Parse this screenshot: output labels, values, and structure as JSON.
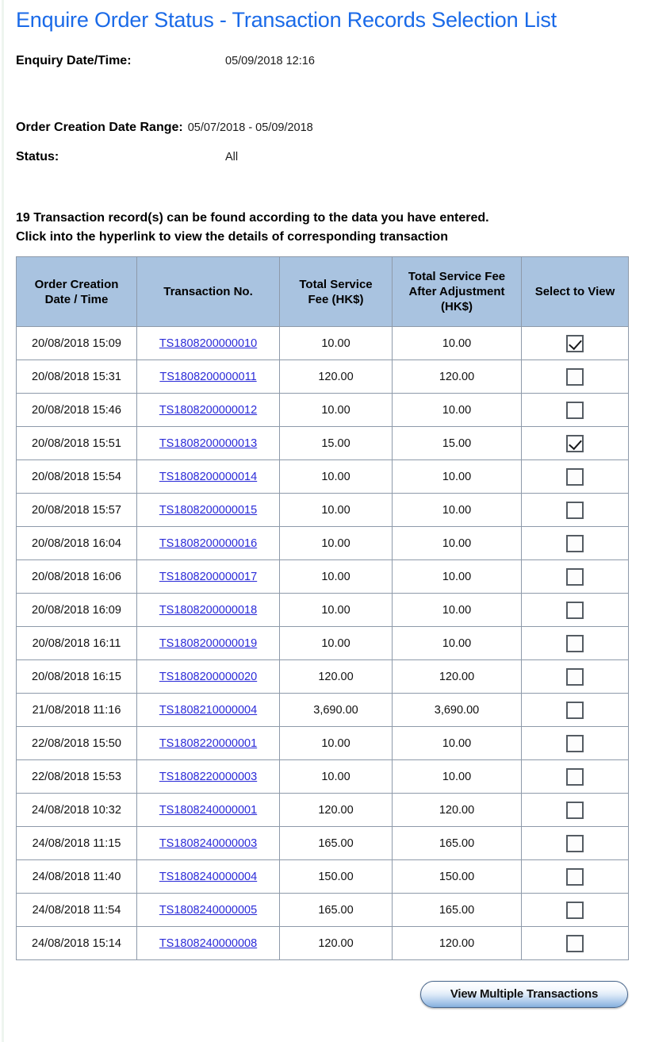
{
  "page": {
    "title": "Enquire Order Status - Transaction Records Selection List",
    "title_color": "#1a6ae8"
  },
  "meta": {
    "enquiry_label": "Enquiry Date/Time:",
    "enquiry_value": "05/09/2018 12:16",
    "date_range_label": "Order Creation Date Range:",
    "date_range_value": "05/07/2018 - 05/09/2018",
    "status_label": "Status:",
    "status_value": "All"
  },
  "result_note": {
    "line1": "19 Transaction record(s) can be found according to the data you have entered.",
    "line2": "Click into the hyperlink to view the details of corresponding transaction",
    "record_count": 19
  },
  "table": {
    "header_bg": "#a9c3e0",
    "columns": [
      "Order Creation Date / Time",
      "Transaction No.",
      "Total Service Fee (HK$)",
      "Total Service Fee After Adjustment (HK$)",
      "Select to View"
    ],
    "columns_lines": [
      [
        "Order Creation",
        "Date / Time"
      ],
      [
        "Transaction No."
      ],
      [
        "Total Service",
        "Fee (HK$)"
      ],
      [
        "Total Service Fee",
        "After Adjustment",
        "(HK$)"
      ],
      [
        "Select to View"
      ]
    ],
    "link_color": "#2b2bd8",
    "rows": [
      {
        "date": "20/08/2018 15:09",
        "txn": "TS1808200000010",
        "fee": "10.00",
        "fee_adj": "10.00",
        "selected": true
      },
      {
        "date": "20/08/2018 15:31",
        "txn": "TS1808200000011",
        "fee": "120.00",
        "fee_adj": "120.00",
        "selected": false
      },
      {
        "date": "20/08/2018 15:46",
        "txn": "TS1808200000012",
        "fee": "10.00",
        "fee_adj": "10.00",
        "selected": false
      },
      {
        "date": "20/08/2018 15:51",
        "txn": "TS1808200000013",
        "fee": "15.00",
        "fee_adj": "15.00",
        "selected": true
      },
      {
        "date": "20/08/2018 15:54",
        "txn": "TS1808200000014",
        "fee": "10.00",
        "fee_adj": "10.00",
        "selected": false
      },
      {
        "date": "20/08/2018 15:57",
        "txn": "TS1808200000015",
        "fee": "10.00",
        "fee_adj": "10.00",
        "selected": false
      },
      {
        "date": "20/08/2018 16:04",
        "txn": "TS1808200000016",
        "fee": "10.00",
        "fee_adj": "10.00",
        "selected": false
      },
      {
        "date": "20/08/2018 16:06",
        "txn": "TS1808200000017",
        "fee": "10.00",
        "fee_adj": "10.00",
        "selected": false
      },
      {
        "date": "20/08/2018 16:09",
        "txn": "TS1808200000018",
        "fee": "10.00",
        "fee_adj": "10.00",
        "selected": false
      },
      {
        "date": "20/08/2018 16:11",
        "txn": "TS1808200000019",
        "fee": "10.00",
        "fee_adj": "10.00",
        "selected": false
      },
      {
        "date": "20/08/2018 16:15",
        "txn": "TS1808200000020",
        "fee": "120.00",
        "fee_adj": "120.00",
        "selected": false
      },
      {
        "date": "21/08/2018 11:16",
        "txn": "TS1808210000004",
        "fee": "3,690.00",
        "fee_adj": "3,690.00",
        "selected": false
      },
      {
        "date": "22/08/2018 15:50",
        "txn": "TS1808220000001",
        "fee": "10.00",
        "fee_adj": "10.00",
        "selected": false
      },
      {
        "date": "22/08/2018 15:53",
        "txn": "TS1808220000003",
        "fee": "10.00",
        "fee_adj": "10.00",
        "selected": false
      },
      {
        "date": "24/08/2018 10:32",
        "txn": "TS1808240000001",
        "fee": "120.00",
        "fee_adj": "120.00",
        "selected": false
      },
      {
        "date": "24/08/2018 11:15",
        "txn": "TS1808240000003",
        "fee": "165.00",
        "fee_adj": "165.00",
        "selected": false
      },
      {
        "date": "24/08/2018 11:40",
        "txn": "TS1808240000004",
        "fee": "150.00",
        "fee_adj": "150.00",
        "selected": false
      },
      {
        "date": "24/08/2018 11:54",
        "txn": "TS1808240000005",
        "fee": "165.00",
        "fee_adj": "165.00",
        "selected": false
      },
      {
        "date": "24/08/2018 15:14",
        "txn": "TS1808240000008",
        "fee": "120.00",
        "fee_adj": "120.00",
        "selected": false
      }
    ]
  },
  "footer": {
    "view_multiple_label": "View Multiple Transactions"
  }
}
